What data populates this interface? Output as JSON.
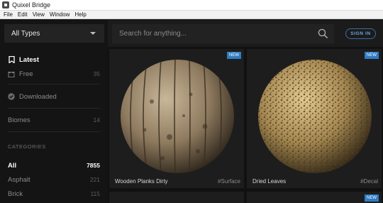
{
  "window": {
    "title": "Quixel Bridge"
  },
  "menu": [
    "File",
    "Edit",
    "View",
    "Window",
    "Help"
  ],
  "sidebar": {
    "type_select": {
      "value": "All Types"
    },
    "nav": [
      {
        "label": "Latest",
        "count": "",
        "icon": "bookmark-icon"
      },
      {
        "label": "Free",
        "count": "35",
        "icon": "gift-icon"
      },
      {
        "label": "Downloaded",
        "count": "",
        "icon": "check-circle-icon"
      },
      {
        "label": "Biomes",
        "count": "14",
        "icon": ""
      }
    ],
    "categories_heading": "CATEGORIES",
    "categories": [
      {
        "label": "All",
        "count": "7855"
      },
      {
        "label": "Asphalt",
        "count": "221"
      },
      {
        "label": "Brick",
        "count": "115"
      }
    ]
  },
  "header": {
    "search_placeholder": "Search for anything...",
    "signin_label": "SIGN IN"
  },
  "cards": [
    {
      "name": "Wooden Planks Dirty",
      "tag": "#Surface",
      "badge": "NEW"
    },
    {
      "name": "Dried Leaves",
      "tag": "#Decal",
      "badge": "NEW"
    }
  ],
  "next_row_badge": "NEW",
  "colors": {
    "accent": "#2f7cc3",
    "signin": "#6aa6e3",
    "background": "#111111"
  }
}
